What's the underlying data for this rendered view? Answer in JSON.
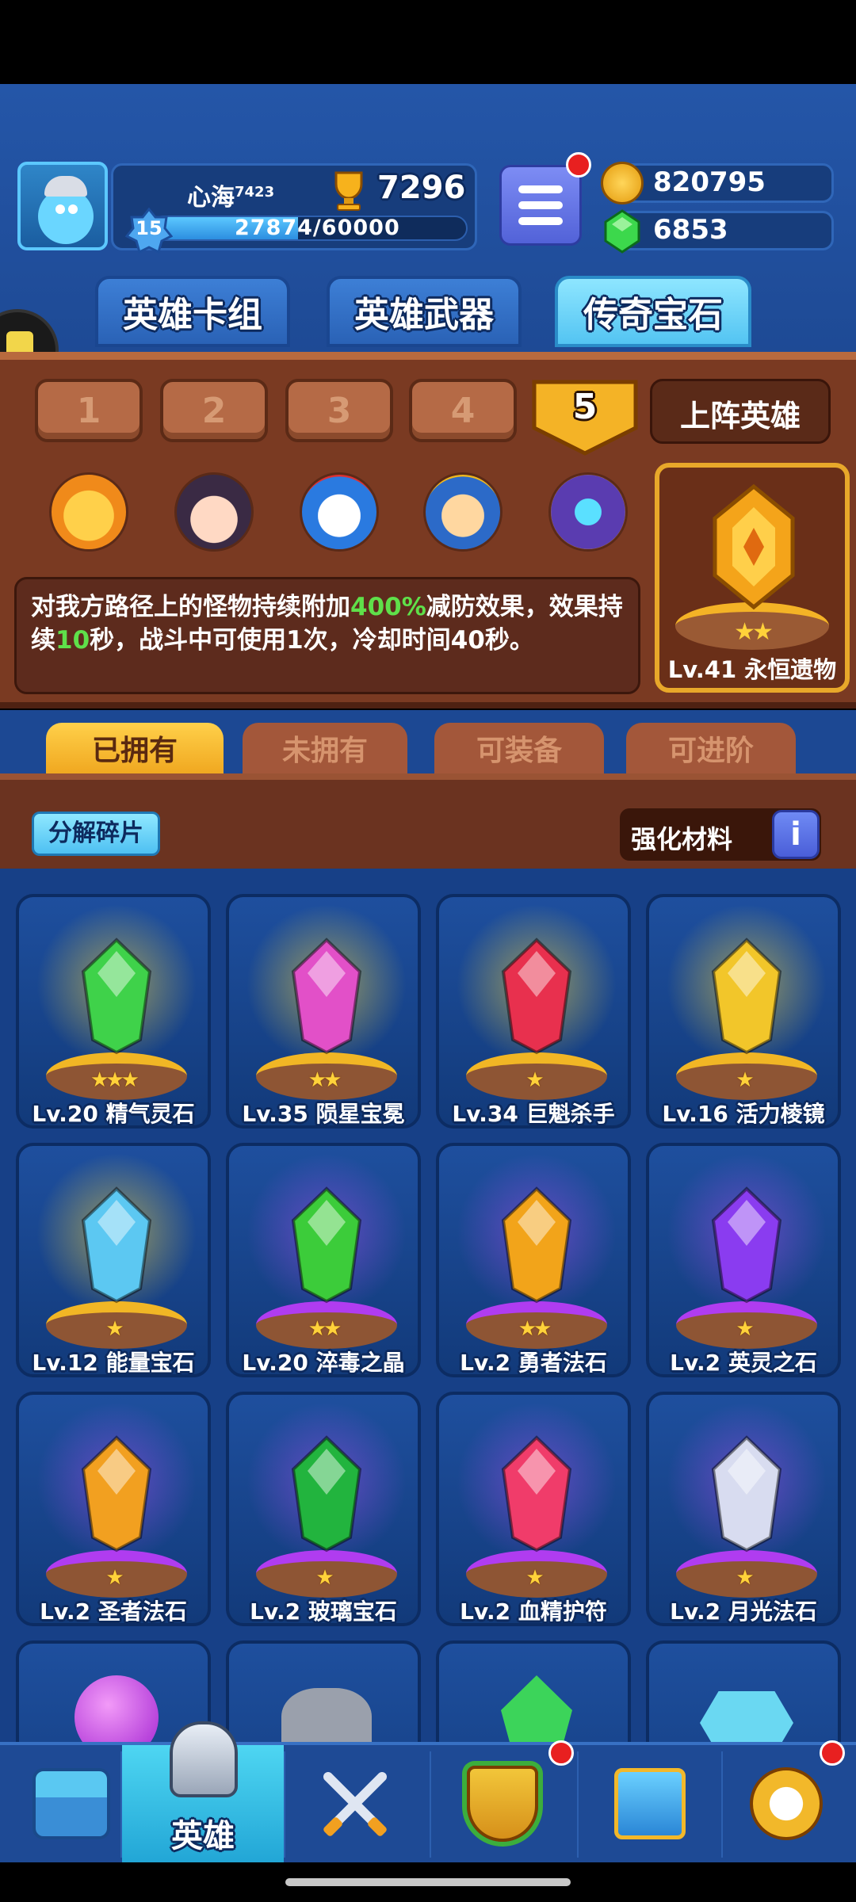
{
  "player": {
    "name": "心海",
    "name_suffix": "7423",
    "level": "15",
    "xp": "27874/60000",
    "xp_fraction": 0.4646,
    "trophies": "7296"
  },
  "currency": {
    "gold": "820795",
    "gems": "6853"
  },
  "main_tabs": [
    "英雄卡组",
    "英雄武器",
    "传奇宝石"
  ],
  "active_main_tab": 2,
  "loadout_tabs": [
    "1",
    "2",
    "3",
    "4",
    "5"
  ],
  "active_loadout": 4,
  "loadout_label": "上阵英雄",
  "description": {
    "part1": "对我方路径上的怪物持续附加",
    "highlight1": "400%",
    "part2": "减防效果，效果持续",
    "highlight2": "10",
    "part3": "秒，战斗中可使用1次，冷却时间40秒。"
  },
  "featured_gem": {
    "label": "Lv.41 永恒遗物",
    "stars": "★★"
  },
  "filter_tabs": [
    "已拥有",
    "未拥有",
    "可装备",
    "可进阶"
  ],
  "active_filter": 0,
  "buttons": {
    "decompose": "分解碎片",
    "enhance": "强化材料"
  },
  "gems": [
    {
      "label": "Lv.20 精气灵石",
      "stars": "★★★",
      "color": "#3fd24a",
      "pedestal": "gold"
    },
    {
      "label": "Lv.35 陨星宝冕",
      "stars": "★★",
      "color": "#e250c8",
      "pedestal": "gold"
    },
    {
      "label": "Lv.34 巨魁杀手",
      "stars": "★",
      "color": "#e8304e",
      "pedestal": "gold"
    },
    {
      "label": "Lv.16 活力棱镜",
      "stars": "★",
      "color": "#f2c62a",
      "pedestal": "gold"
    },
    {
      "label": "Lv.12 能量宝石",
      "stars": "★",
      "color": "#5cc8f2",
      "pedestal": "gold"
    },
    {
      "label": "Lv.20 淬毒之晶",
      "stars": "★★",
      "color": "#3ccc3a",
      "pedestal": "purple"
    },
    {
      "label": "Lv.2 勇者法石",
      "stars": "★★",
      "color": "#f2a41a",
      "pedestal": "purple"
    },
    {
      "label": "Lv.2 英灵之石",
      "stars": "★",
      "color": "#8a3cf0",
      "pedestal": "purple"
    },
    {
      "label": "Lv.2 圣者法石",
      "stars": "★",
      "color": "#f2a020",
      "pedestal": "purple"
    },
    {
      "label": "Lv.2 玻璃宝石",
      "stars": "★",
      "color": "#22b43e",
      "pedestal": "purple"
    },
    {
      "label": "Lv.2 血精护符",
      "stars": "★",
      "color": "#f03c6a",
      "pedestal": "purple"
    },
    {
      "label": "Lv.2 月光法石",
      "stars": "★",
      "color": "#d8dcf0",
      "pedestal": "purple"
    }
  ],
  "nav": {
    "active_label": "英雄"
  }
}
